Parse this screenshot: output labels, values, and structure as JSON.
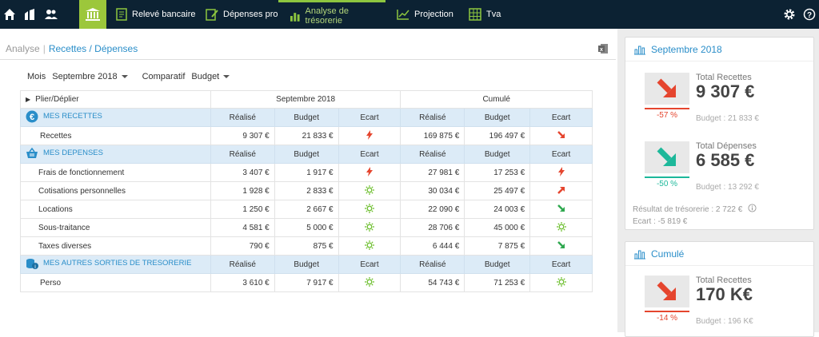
{
  "nav": {
    "items": [
      {
        "label": "Relevé bancaire"
      },
      {
        "label": "Dépenses pro"
      },
      {
        "label": "Analyse de trésorerie"
      },
      {
        "label": "Projection"
      },
      {
        "label": "Tva"
      }
    ]
  },
  "breadcrumb": {
    "root": "Analyse",
    "current": "Recettes / Dépenses"
  },
  "filters": {
    "mois_label": "Mois",
    "mois_value": "Septembre 2018",
    "comparatif_label": "Comparatif",
    "comparatif_value": "Budget"
  },
  "table": {
    "toggle_label": "Plier/Déplier",
    "period_header": "Septembre 2018",
    "cumul_header": "Cumulé",
    "col_realise": "Réalisé",
    "col_budget": "Budget",
    "col_ecart": "Ecart",
    "sections": [
      {
        "title": "MES RECETTES",
        "rows": [
          {
            "label": "Recettes",
            "realise": "9 307 €",
            "budget": "21 833 €",
            "cum_realise": "169 875 €",
            "cum_budget": "196 497 €"
          }
        ]
      },
      {
        "title": "MES DEPENSES",
        "rows": [
          {
            "label": "Frais de fonctionnement",
            "realise": "3 407 €",
            "budget": "1 917 €",
            "cum_realise": "27 981 €",
            "cum_budget": "17 253 €"
          },
          {
            "label": "Cotisations personnelles",
            "realise": "1 928 €",
            "budget": "2 833 €",
            "cum_realise": "30 034 €",
            "cum_budget": "25 497 €"
          },
          {
            "label": "Locations",
            "realise": "1 250 €",
            "budget": "2 667 €",
            "cum_realise": "22 090 €",
            "cum_budget": "24 003 €"
          },
          {
            "label": "Sous-traitance",
            "realise": "4 581 €",
            "budget": "5 000 €",
            "cum_realise": "28 706 €",
            "cum_budget": "45 000 €"
          },
          {
            "label": "Taxes diverses",
            "realise": "790 €",
            "budget": "875 €",
            "cum_realise": "6 444 €",
            "cum_budget": "7 875 €"
          }
        ]
      },
      {
        "title": "MES AUTRES SORTIES DE TRESORERIE",
        "rows": [
          {
            "label": "Perso",
            "realise": "3 610 €",
            "budget": "7 917 €",
            "cum_realise": "54 743 €",
            "cum_budget": "71 253 €"
          }
        ]
      }
    ]
  },
  "sidebar": {
    "month_card": {
      "title": "Septembre 2018",
      "recettes": {
        "label": "Total Recettes",
        "value": "9 307 €",
        "pct": "-57 %",
        "budget": "Budget : 21 833 €"
      },
      "depenses": {
        "label": "Total Dépenses",
        "value": "6 585 €",
        "pct": "-50 %",
        "budget": "Budget : 13 292 €"
      },
      "resultat": "Résultat de trésorerie : 2 722 €",
      "ecart": "Ecart : -5 819 €"
    },
    "cumul_card": {
      "title": "Cumulé",
      "recettes": {
        "label": "Total Recettes",
        "value": "170 K€",
        "pct": "-14 %",
        "budget": "Budget : 196 K€"
      }
    }
  },
  "colors": {
    "topbar": "#0c2233",
    "accent_green": "#8dc63f",
    "link_blue": "#2a8ec9",
    "red": "#e5452e",
    "teal": "#1db89a"
  }
}
